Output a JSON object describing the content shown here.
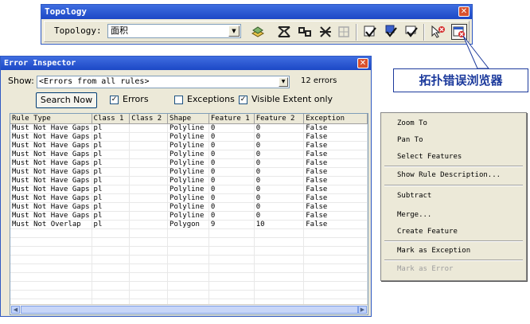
{
  "topology_toolbar": {
    "title": "Topology",
    "label": "Topology:",
    "selected_topology": "面积",
    "tools": [
      "topology-edit-tool-icon",
      "fix-topology-error-icon",
      "construct-features-icon",
      "planarize-icon",
      "shared-features-icon",
      "validate-edits-icon",
      "validate-extent-icon",
      "validate-topology-icon",
      "fix-error-tool-icon",
      "error-inspector-icon"
    ]
  },
  "callout": {
    "text": "拓扑错误浏览器"
  },
  "error_inspector": {
    "title": "Error Inspector",
    "show_label": "Show:",
    "show_value": "<Errors from all rules>",
    "count": "12 errors",
    "search_button": "Search Now",
    "checkboxes": [
      {
        "label": "Errors",
        "checked": true
      },
      {
        "label": "Exceptions",
        "checked": false
      },
      {
        "label": "Visible Extent only",
        "checked": true
      }
    ],
    "columns": [
      "Rule Type",
      "Class 1",
      "Class 2",
      "Shape",
      "Feature 1",
      "Feature 2",
      "Exception"
    ],
    "rows": [
      [
        "Must Not Have Gaps",
        "pl",
        "",
        "Polyline",
        "0",
        "0",
        "False"
      ],
      [
        "Must Not Have Gaps",
        "pl",
        "",
        "Polyline",
        "0",
        "0",
        "False"
      ],
      [
        "Must Not Have Gaps",
        "pl",
        "",
        "Polyline",
        "0",
        "0",
        "False"
      ],
      [
        "Must Not Have Gaps",
        "pl",
        "",
        "Polyline",
        "0",
        "0",
        "False"
      ],
      [
        "Must Not Have Gaps",
        "pl",
        "",
        "Polyline",
        "0",
        "0",
        "False"
      ],
      [
        "Must Not Have Gaps",
        "pl",
        "",
        "Polyline",
        "0",
        "0",
        "False"
      ],
      [
        "Must Not Have Gaps",
        "pl",
        "",
        "Polyline",
        "0",
        "0",
        "False"
      ],
      [
        "Must Not Have Gaps",
        "pl",
        "",
        "Polyline",
        "0",
        "0",
        "False"
      ],
      [
        "Must Not Have Gaps",
        "pl",
        "",
        "Polyline",
        "0",
        "0",
        "False"
      ],
      [
        "Must Not Have Gaps",
        "pl",
        "",
        "Polyline",
        "0",
        "0",
        "False"
      ],
      [
        "Must Not Have Gaps",
        "pl",
        "",
        "Polyline",
        "0",
        "0",
        "False"
      ],
      [
        "Must Not Overlap",
        "pl",
        "",
        "Polygon",
        "9",
        "10",
        "False"
      ]
    ]
  },
  "context_menu": {
    "items": [
      {
        "label": "Zoom To",
        "enabled": true
      },
      {
        "label": "Pan To",
        "enabled": true
      },
      {
        "label": "Select Features",
        "enabled": true
      },
      {
        "label": "Show Rule Description...",
        "enabled": true
      },
      {
        "label": "Subtract",
        "enabled": true
      },
      {
        "label": "Merge...",
        "enabled": true
      },
      {
        "label": "Create Feature",
        "enabled": true
      },
      {
        "label": "Mark as Exception",
        "enabled": true
      },
      {
        "label": "Mark as Error",
        "enabled": false
      }
    ]
  }
}
